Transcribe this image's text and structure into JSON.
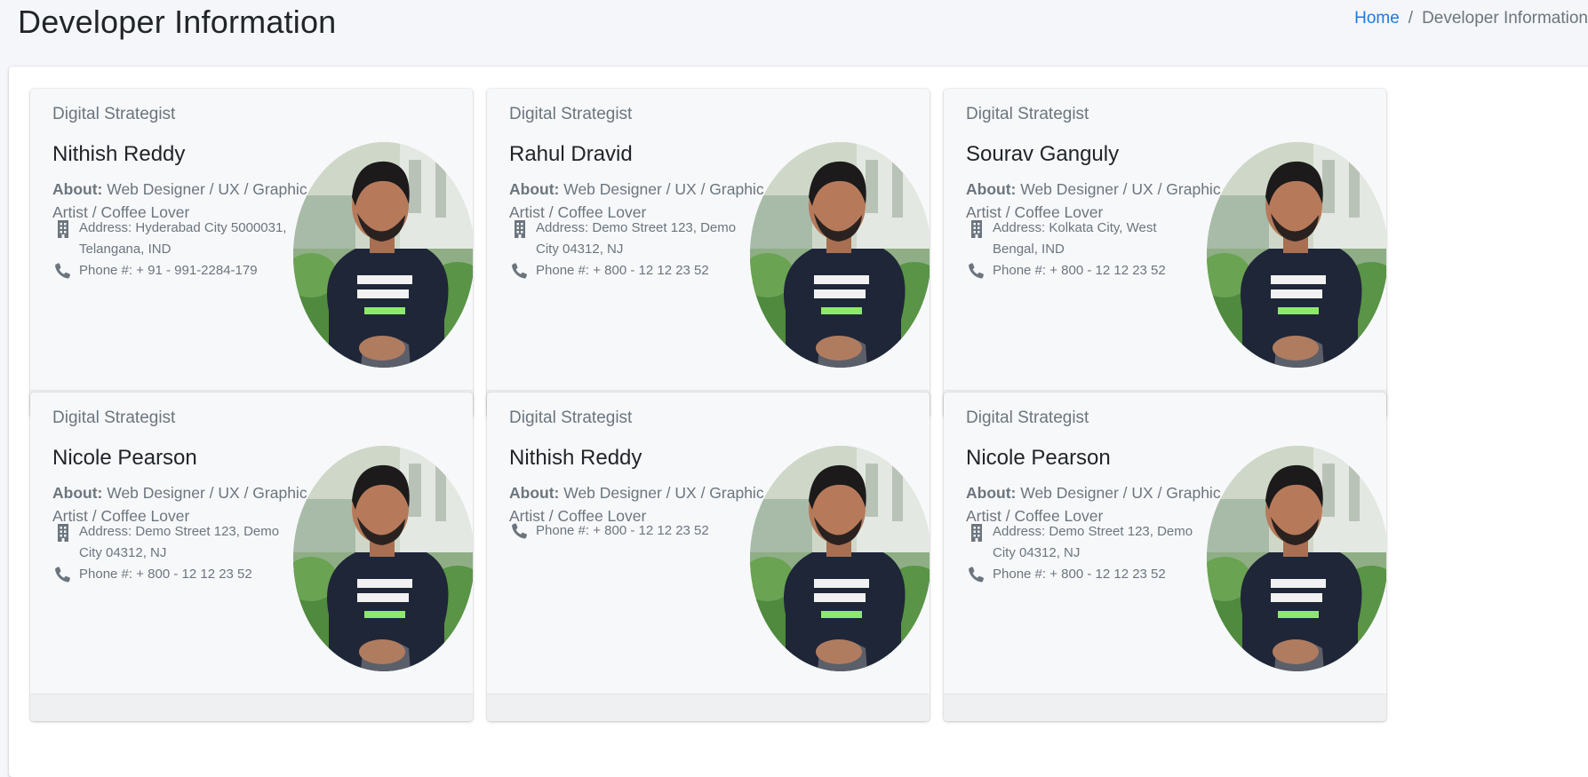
{
  "header": {
    "title": "Developer Information",
    "breadcrumb": {
      "home": "Home",
      "separator": "/",
      "current": "Developer Information"
    }
  },
  "cards": [
    {
      "role": "Digital Strategist",
      "name": "Nithish Reddy",
      "about_label": "About:",
      "about": "Web Designer / UX / Graphic Artist / Coffee Lover",
      "address": "Address: Hyderabad City 5000031, Telangana, IND",
      "phone": "Phone #: + 91 - 991-2284-179"
    },
    {
      "role": "Digital Strategist",
      "name": "Rahul Dravid",
      "about_label": "About:",
      "about": "Web Designer / UX / Graphic Artist / Coffee Lover",
      "address": "Address: Demo Street 123, Demo City 04312, NJ",
      "phone": "Phone #: + 800 - 12 12 23 52"
    },
    {
      "role": "Digital Strategist",
      "name": "Sourav Ganguly",
      "about_label": "About:",
      "about": "Web Designer / UX / Graphic Artist / Coffee Lover",
      "address": "Address: Kolkata City, West Bengal, IND",
      "phone": "Phone #: + 800 - 12 12 23 52"
    },
    {
      "role": "Digital Strategist",
      "name": "Nicole Pearson",
      "about_label": "About:",
      "about": "Web Designer / UX / Graphic Artist / Coffee Lover",
      "address": "Address: Demo Street 123, Demo City 04312, NJ",
      "phone": "Phone #: + 800 - 12 12 23 52"
    },
    {
      "role": "Digital Strategist",
      "name": "Nithish Reddy",
      "about_label": "About:",
      "about": "Web Designer / UX / Graphic Artist / Coffee Lover",
      "phone": "Phone #: + 800 - 12 12 23 52"
    },
    {
      "role": "Digital Strategist",
      "name": "Nicole Pearson",
      "about_label": "About:",
      "about": "Web Designer / UX / Graphic Artist / Coffee Lover",
      "address": "Address: Demo Street 123, Demo City 04312, NJ",
      "phone": "Phone #: + 800 - 12 12 23 52"
    }
  ],
  "icons": {
    "address": "building-icon",
    "phone": "phone-icon",
    "photo": "user-avatar"
  },
  "colors": {
    "link": "#1f7ae0",
    "muted": "#6c757d",
    "card_bg": "#f7f8fa",
    "page_bg": "#f4f6f9"
  }
}
